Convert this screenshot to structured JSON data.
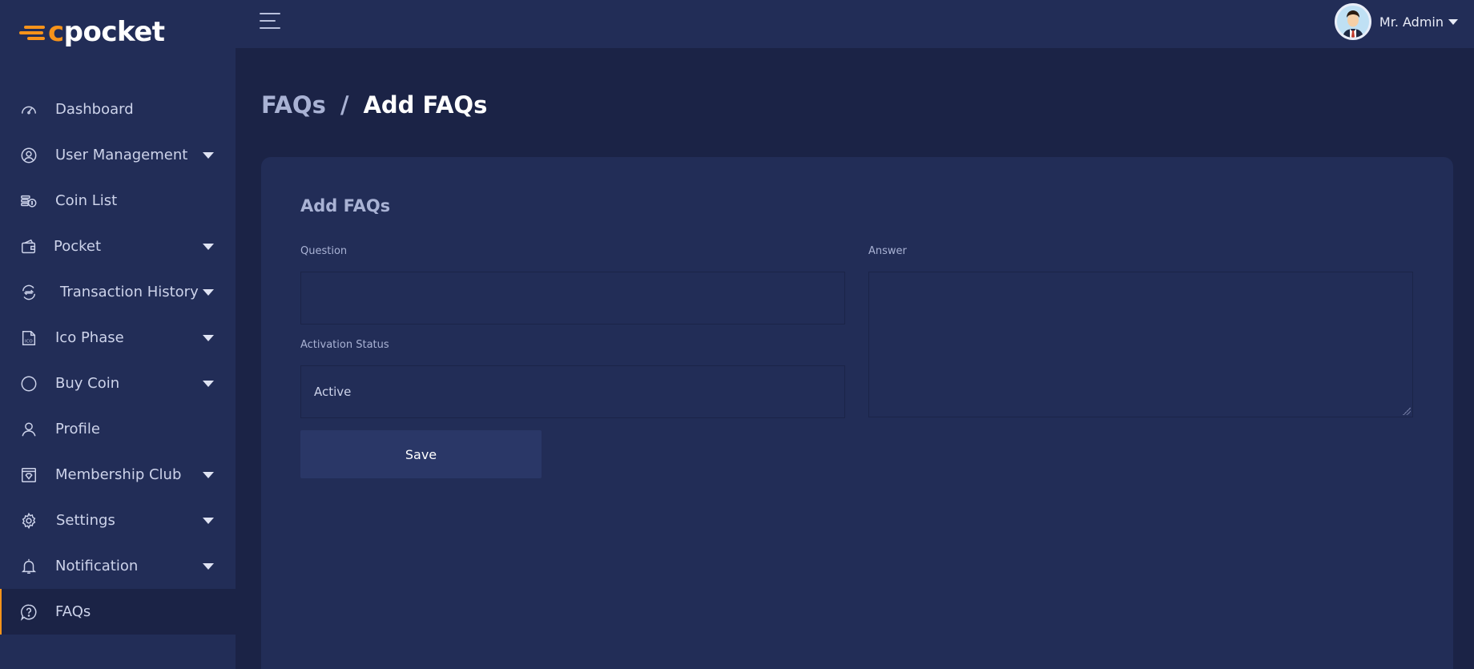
{
  "app": {
    "logo_text_c": "c",
    "logo_text_rest": "pocket"
  },
  "sidebar": {
    "items": [
      {
        "label": "Dashboard",
        "icon": "gauge-icon",
        "has_caret": false
      },
      {
        "label": "User Management",
        "icon": "user-circle-icon",
        "has_caret": true
      },
      {
        "label": "Coin List",
        "icon": "coins-icon",
        "has_caret": false
      },
      {
        "label": "Pocket",
        "icon": "wallet-icon",
        "has_caret": true
      },
      {
        "label": "Transaction History",
        "icon": "exchange-icon",
        "has_caret": true
      },
      {
        "label": "Ico Phase",
        "icon": "ico-file-icon",
        "has_caret": true
      },
      {
        "label": "Buy Coin",
        "icon": "circle-icon",
        "has_caret": true
      },
      {
        "label": "Profile",
        "icon": "person-icon",
        "has_caret": false
      },
      {
        "label": "Membership Club",
        "icon": "diamond-card-icon",
        "has_caret": true
      },
      {
        "label": "Settings",
        "icon": "gear-icon",
        "has_caret": true
      },
      {
        "label": "Notification",
        "icon": "bell-icon",
        "has_caret": true
      },
      {
        "label": "FAQs",
        "icon": "question-bubble-icon",
        "has_caret": false,
        "active": true
      }
    ]
  },
  "header": {
    "user_name": "Mr. Admin"
  },
  "breadcrumb": {
    "parent": "FAQs",
    "separator": "/",
    "current": "Add FAQs"
  },
  "form": {
    "title": "Add FAQs",
    "question_label": "Question",
    "question_value": "",
    "answer_label": "Answer",
    "answer_value": "",
    "status_label": "Activation Status",
    "status_value": "Active",
    "save_label": "Save"
  },
  "colors": {
    "accent": "#f7931a",
    "sidebar_bg": "#222d57",
    "page_bg": "#1b2346",
    "card_bg": "#222d57",
    "button_bg": "#2a3767"
  }
}
